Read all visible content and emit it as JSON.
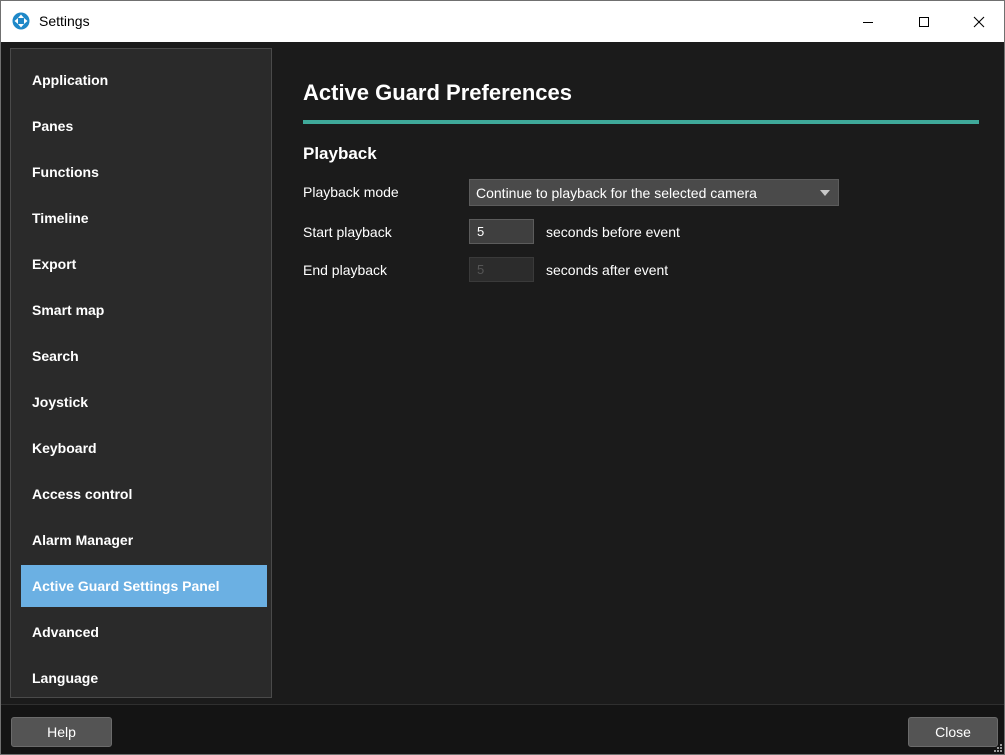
{
  "window": {
    "title": "Settings"
  },
  "sidebar": {
    "items": [
      {
        "label": "Application"
      },
      {
        "label": "Panes"
      },
      {
        "label": "Functions"
      },
      {
        "label": "Timeline"
      },
      {
        "label": "Export"
      },
      {
        "label": "Smart map"
      },
      {
        "label": "Search"
      },
      {
        "label": "Joystick"
      },
      {
        "label": "Keyboard"
      },
      {
        "label": "Access control"
      },
      {
        "label": "Alarm Manager"
      },
      {
        "label": "Active Guard Settings Panel"
      },
      {
        "label": "Advanced"
      },
      {
        "label": "Language"
      }
    ],
    "active_index": 11
  },
  "main": {
    "title": "Active Guard Preferences",
    "section": "Playback",
    "playback_mode": {
      "label": "Playback mode",
      "value": "Continue to playback for the selected camera"
    },
    "start_playback": {
      "label": "Start playback",
      "value": "5",
      "suffix": "seconds before event"
    },
    "end_playback": {
      "label": "End playback",
      "value": "5",
      "suffix": "seconds after event",
      "disabled": true
    }
  },
  "footer": {
    "help_label": "Help",
    "close_label": "Close"
  },
  "colors": {
    "accent_rule": "#3fa99a",
    "active_nav": "#6bb0e3",
    "app_icon": "#1e88c8"
  },
  "icons": {
    "app": "milestone-app-icon",
    "minimize": "minimize-icon",
    "maximize": "maximize-icon",
    "close": "close-icon",
    "dropdown": "chevron-down-icon"
  }
}
